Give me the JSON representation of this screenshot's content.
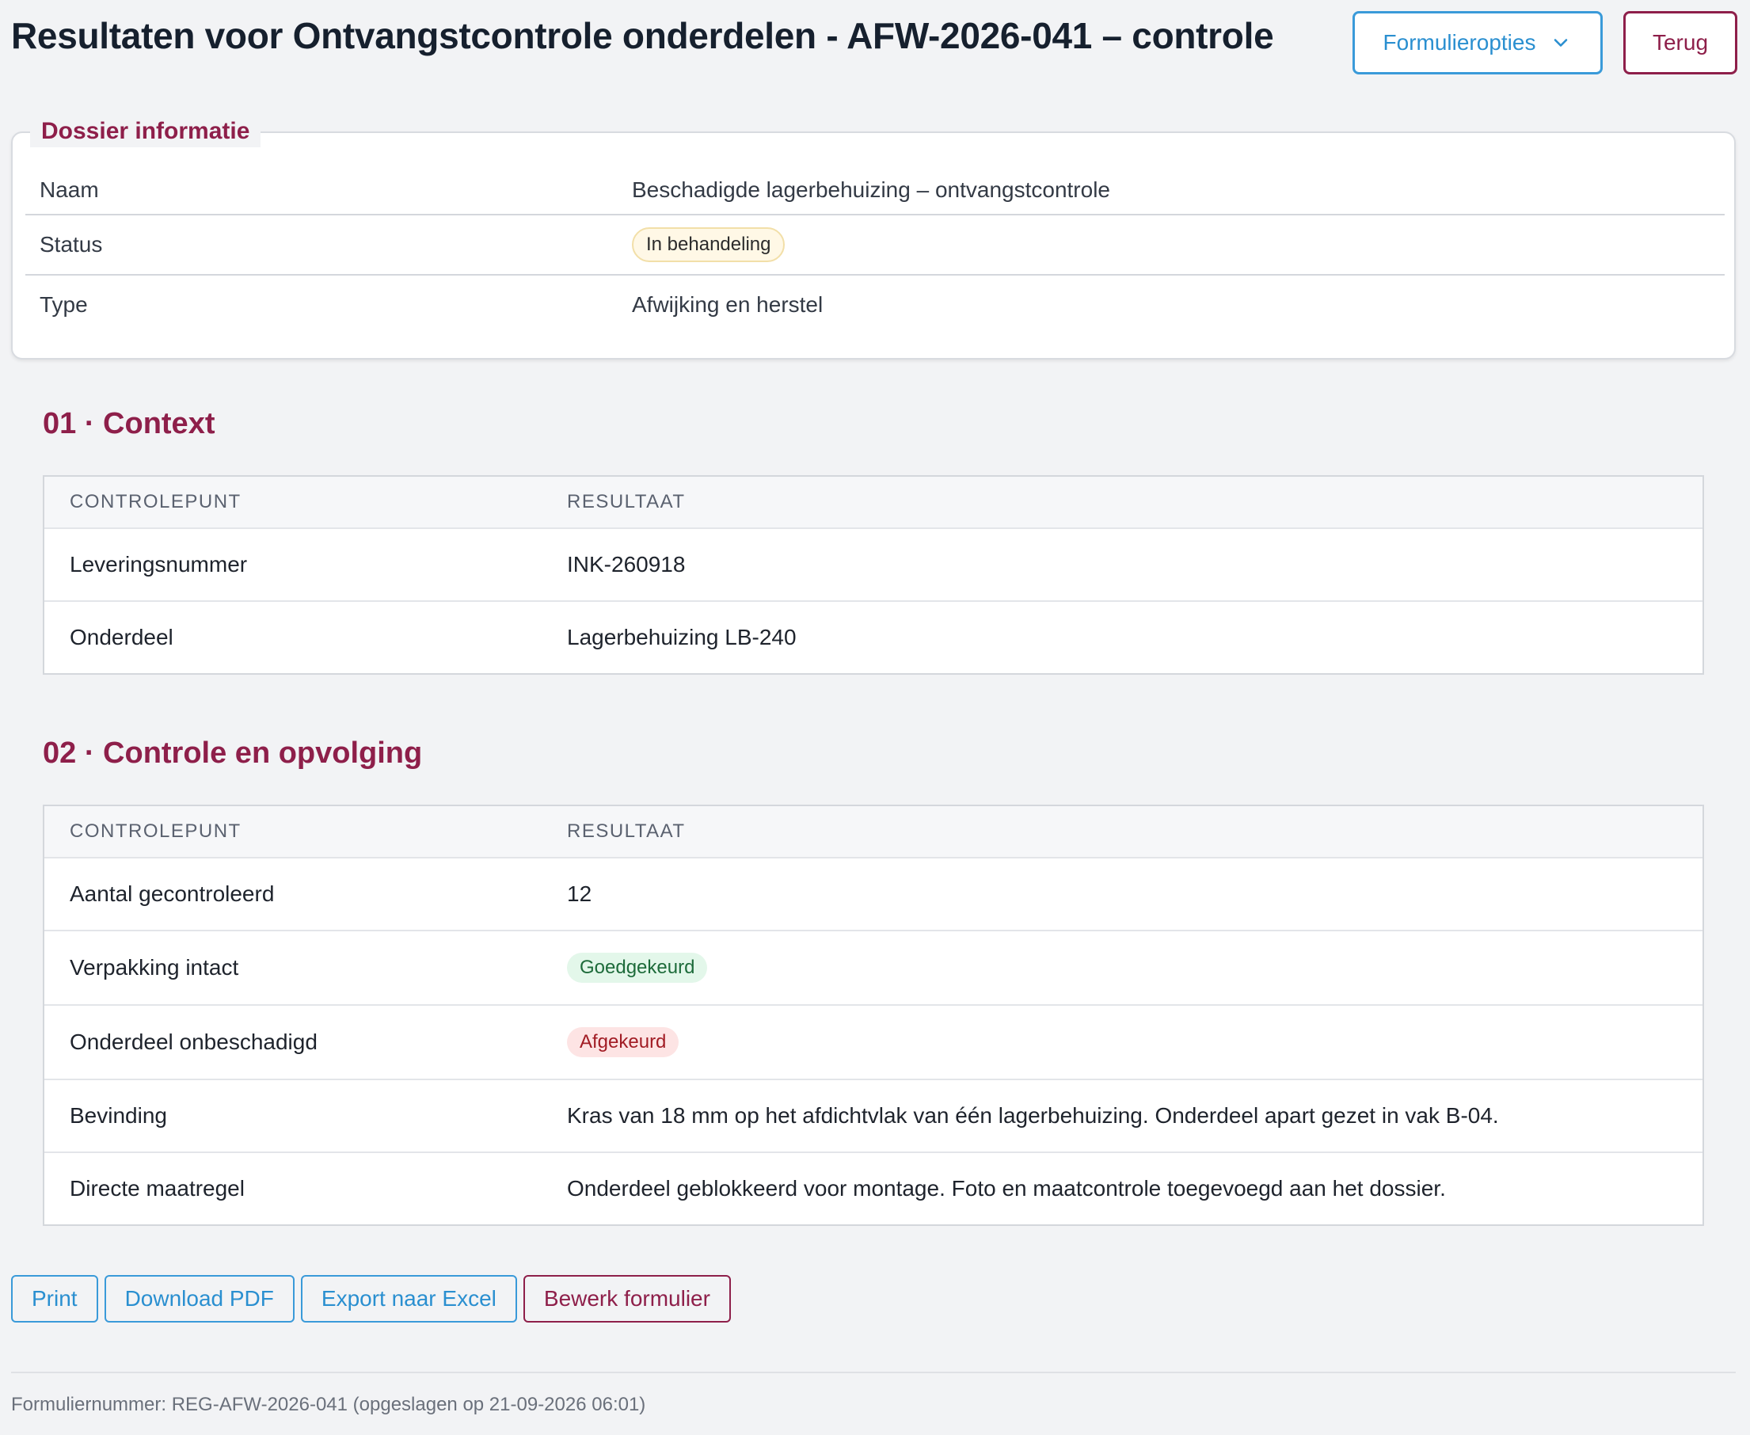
{
  "header": {
    "title": "Resultaten voor Ontvangstcontrole onderdelen - AFW-2026-041 – controle",
    "options_label": "Formulieropties",
    "back_label": "Terug"
  },
  "dossier": {
    "legend": "Dossier informatie",
    "rows": [
      {
        "key": "Naam",
        "value": "Beschadigde lagerbehuizing – ontvangstcontrole"
      },
      {
        "key": "Status",
        "value": "In behandeling"
      },
      {
        "key": "Type",
        "value": "Afwijking en herstel"
      }
    ]
  },
  "sections": [
    {
      "title": "01 · Context",
      "columns": [
        "CONTROLEPUNT",
        "RESULTAAT"
      ],
      "rows": [
        {
          "point": "Leveringsnummer",
          "result": "INK-260918"
        },
        {
          "point": "Onderdeel",
          "result": "Lagerbehuizing LB-240"
        }
      ]
    },
    {
      "title": "02 · Controle en opvolging",
      "columns": [
        "CONTROLEPUNT",
        "RESULTAAT"
      ],
      "rows": [
        {
          "point": "Aantal gecontroleerd",
          "result": "12"
        },
        {
          "point": "Verpakking intact",
          "result": "Goedgekeurd"
        },
        {
          "point": "Onderdeel onbeschadigd",
          "result": "Afgekeurd"
        },
        {
          "point": "Bevinding",
          "result": "Kras van 18 mm op het afdichtvlak van één lagerbehuizing. Onderdeel apart gezet in vak B-04."
        },
        {
          "point": "Directe maatregel",
          "result": "Onderdeel geblokkeerd voor montage. Foto en maatcontrole toegevoegd aan het dossier."
        }
      ]
    }
  ],
  "actions": {
    "print": "Print",
    "download_pdf": "Download PDF",
    "export_excel": "Export naar Excel",
    "edit_form": "Bewerk formulier"
  },
  "footer": {
    "text": "Formuliernummer: REG-AFW-2026-041 (opgeslagen op 21-09-2026 06:01)"
  },
  "icons": {
    "options_dropdown": "chevron-down-icon"
  },
  "colors": {
    "accent": "#8e1f4a",
    "link": "#2a8fd0",
    "ok": "#1d6b3a",
    "bad": "#a11c24"
  }
}
